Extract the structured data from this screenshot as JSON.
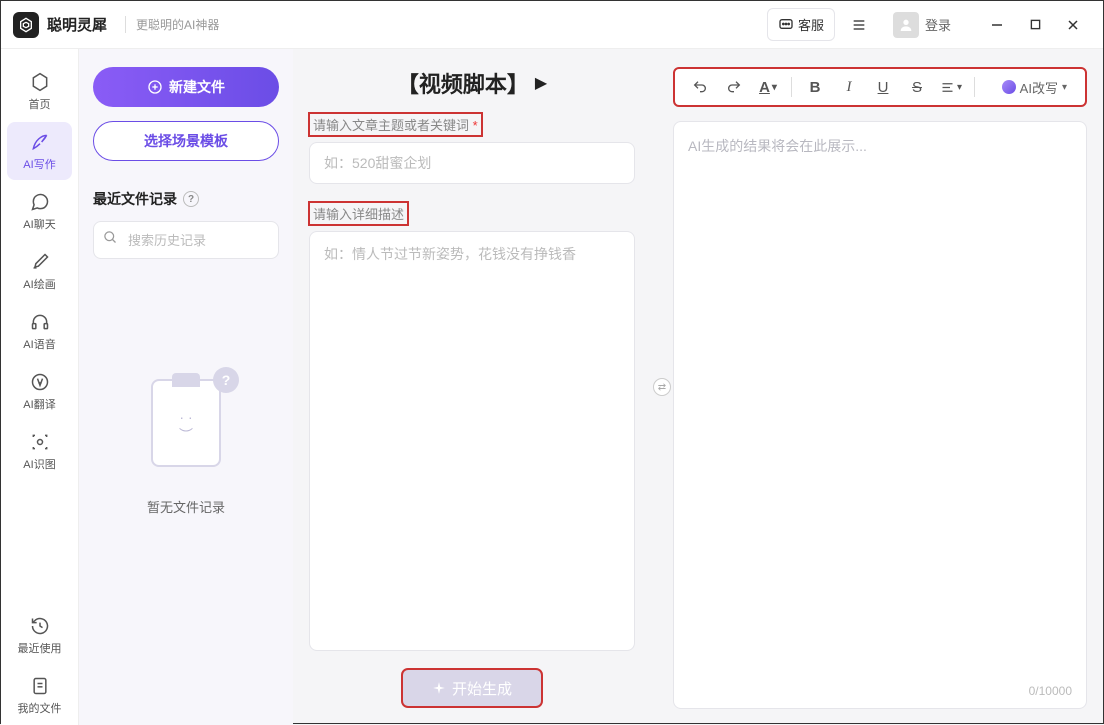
{
  "titlebar": {
    "app_name": "聪明灵犀",
    "tagline": "更聪明的AI神器",
    "customer_service": "客服",
    "login": "登录"
  },
  "sidebar": {
    "items": [
      {
        "label": "首页"
      },
      {
        "label": "AI写作"
      },
      {
        "label": "AI聊天"
      },
      {
        "label": "AI绘画"
      },
      {
        "label": "AI语音"
      },
      {
        "label": "AI翻译"
      },
      {
        "label": "AI识图"
      }
    ],
    "bottom": [
      {
        "label": "最近使用"
      },
      {
        "label": "我的文件"
      }
    ]
  },
  "file_panel": {
    "new_file": "新建文件",
    "select_template": "选择场景模板",
    "recent_header": "最近文件记录",
    "search_placeholder": "搜索历史记录",
    "empty_text": "暂无文件记录"
  },
  "center": {
    "title": "【视频脚本】",
    "label_topic": "请输入文章主题或者关键词",
    "required_mark": "*",
    "topic_placeholder": "如：520甜蜜企划",
    "label_detail": "请输入详细描述",
    "detail_placeholder": "如：情人节过节新姿势，花钱没有挣钱香",
    "generate": "开始生成"
  },
  "right": {
    "rewrite": "AI改写",
    "output_placeholder": "AI生成的结果将会在此展示...",
    "char_count": "0/10000"
  }
}
